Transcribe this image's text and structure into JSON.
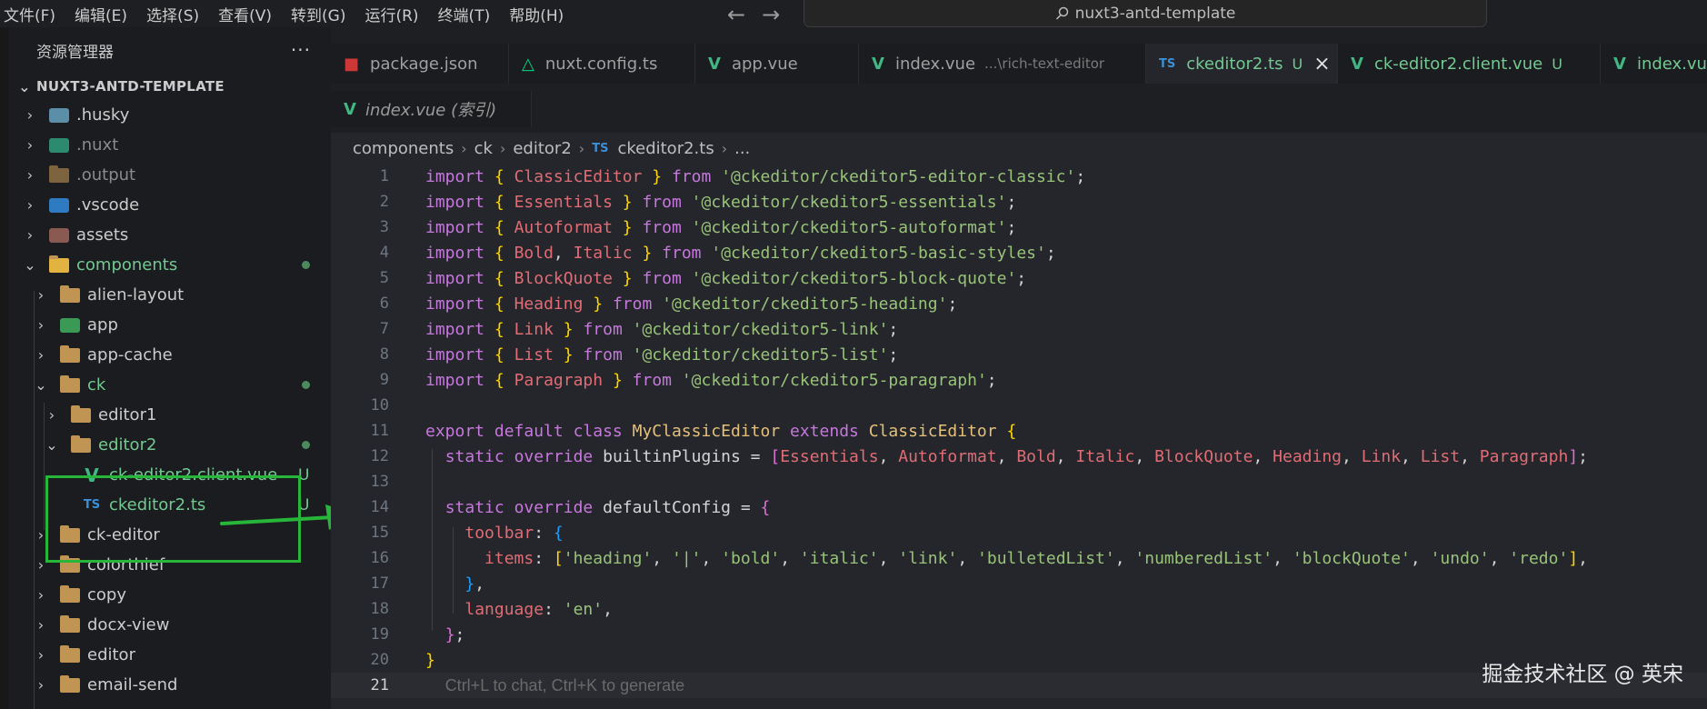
{
  "menu": [
    "文件(F)",
    "编辑(E)",
    "选择(S)",
    "查看(V)",
    "转到(G)",
    "运行(R)",
    "终端(T)",
    "帮助(H)"
  ],
  "nav": {
    "back": "←",
    "forward": "→"
  },
  "search": {
    "icon": "search-icon",
    "text": "nuxt3-antd-template"
  },
  "sidebar": {
    "title": "资源管理器",
    "more": "···",
    "root": "NUXT3-ANTD-TEMPLATE",
    "items": [
      {
        "label": ".husky",
        "icon": "husky-folder-icon",
        "style": "normal"
      },
      {
        "label": ".nuxt",
        "icon": "nuxt-folder-icon",
        "style": "dim"
      },
      {
        "label": ".output",
        "icon": "folder-icon",
        "style": "dim"
      },
      {
        "label": ".vscode",
        "icon": "vscode-folder-icon",
        "style": "normal"
      },
      {
        "label": "assets",
        "icon": "assets-folder-icon",
        "style": "normal"
      },
      {
        "label": "components",
        "icon": "components-folder-icon",
        "style": "green"
      },
      {
        "label": "alien-layout",
        "icon": "folder-icon",
        "style": "normal"
      },
      {
        "label": "app",
        "icon": "app-folder-icon",
        "style": "normal"
      },
      {
        "label": "app-cache",
        "icon": "folder-icon",
        "style": "normal"
      },
      {
        "label": "ck",
        "icon": "folder-open-icon",
        "style": "green"
      },
      {
        "label": "editor1",
        "icon": "folder-icon",
        "style": "normal"
      },
      {
        "label": "editor2",
        "icon": "folder-open-icon",
        "style": "green"
      },
      {
        "label": "ck-editor2.client.vue",
        "icon": "vue-file-icon",
        "style": "green",
        "status": "U"
      },
      {
        "label": "ckeditor2.ts",
        "icon": "ts-file-icon",
        "style": "green",
        "status": "U"
      },
      {
        "label": "ck-editor",
        "icon": "folder-icon",
        "style": "normal"
      },
      {
        "label": "colorthief",
        "icon": "folder-icon",
        "style": "normal"
      },
      {
        "label": "copy",
        "icon": "folder-icon",
        "style": "normal"
      },
      {
        "label": "docx-view",
        "icon": "folder-icon",
        "style": "normal"
      },
      {
        "label": "editor",
        "icon": "folder-icon",
        "style": "normal"
      },
      {
        "label": "email-send",
        "icon": "folder-icon",
        "style": "normal"
      }
    ]
  },
  "tabs": [
    {
      "label": "package.json",
      "icon": "npm-icon"
    },
    {
      "label": "nuxt.config.ts",
      "icon": "nuxt-icon"
    },
    {
      "label": "app.vue",
      "icon": "vue-icon"
    },
    {
      "label": "index.vue",
      "hint": "...\\rich-text-editor",
      "icon": "vue-icon"
    },
    {
      "label": "ckeditor2.ts",
      "badge": "U",
      "close": "×",
      "icon": "ts-icon",
      "active": true
    },
    {
      "label": "ck-editor2.client.vue",
      "badge": "U",
      "icon": "vue-icon"
    },
    {
      "label": "index.vu",
      "icon": "vue-icon"
    }
  ],
  "tab_row2": {
    "label": "index.vue (索引)"
  },
  "breadcrumb": [
    "components",
    "ck",
    "editor2",
    "ckeditor2.ts",
    "..."
  ],
  "breadcrumb_ts": "TS",
  "tab_ts": "TS",
  "tree_ts": "TS",
  "vue_glyph": "V",
  "code_lines": [
    "1",
    "2",
    "3",
    "4",
    "5",
    "6",
    "7",
    "8",
    "9",
    "10",
    "11",
    "12",
    "13",
    "14",
    "15",
    "16",
    "17",
    "18",
    "19",
    "20",
    "21"
  ],
  "ghost_hint": "Ctrl+L to chat, Ctrl+K to generate",
  "watermark": "掘金技术社区 @ 英宋",
  "colors": {
    "accent_green": "#73c991",
    "annotation_green": "#27b53a",
    "keyword": "#c678dd",
    "string": "#98c379",
    "identifier": "#e06c75",
    "class": "#e5c07b"
  }
}
